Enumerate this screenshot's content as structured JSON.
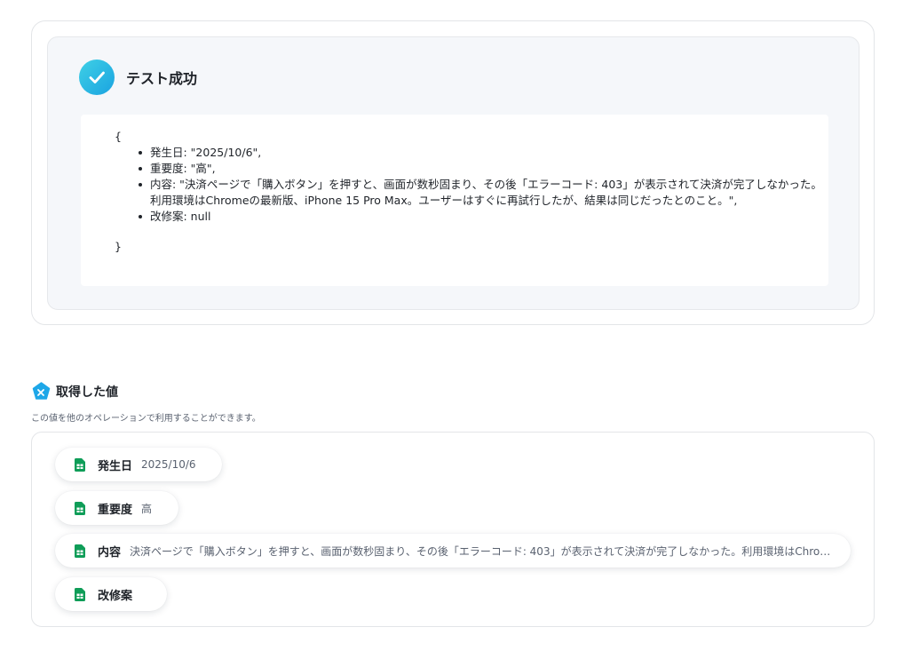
{
  "result": {
    "status_title": "テスト成功",
    "open_brace": "{",
    "close_brace": "}",
    "fields": [
      "発生日: \"2025/10/6\",",
      "重要度: \"高\",",
      "内容: \"決済ページで「購入ボタン」を押すと、画面が数秒固まり、その後「エラーコード: 403」が表示されて決済が完了しなかった。",
      "改修案: null"
    ],
    "content_continuation": "利用環境はChromeの最新版、iPhone 15 Pro Max。ユーザーはすぐに再試行したが、結果は同じだったとのこと。\","
  },
  "section": {
    "title": "取得した値",
    "description": "この値を他のオペレーションで利用することができます。",
    "items": [
      {
        "label": "発生日",
        "value": "2025/10/6"
      },
      {
        "label": "重要度",
        "value": "高"
      },
      {
        "label": "内容",
        "value": "決済ページで「購入ボタン」を押すと、画面が数秒固まり、その後「エラーコード: 403」が表示されて決済が完了しなかった。利用環境はChromeの…"
      },
      {
        "label": "改修案",
        "value": ""
      }
    ]
  },
  "colors": {
    "success_gradient_start": "#3fd0e6",
    "success_gradient_end": "#1aa3e0",
    "sheets_green": "#0f9d58",
    "section_icon_blue": "#1ea7e8"
  },
  "icons": {
    "success": "check-circle-icon",
    "section": "variable-badge-icon",
    "item": "google-sheets-icon"
  }
}
